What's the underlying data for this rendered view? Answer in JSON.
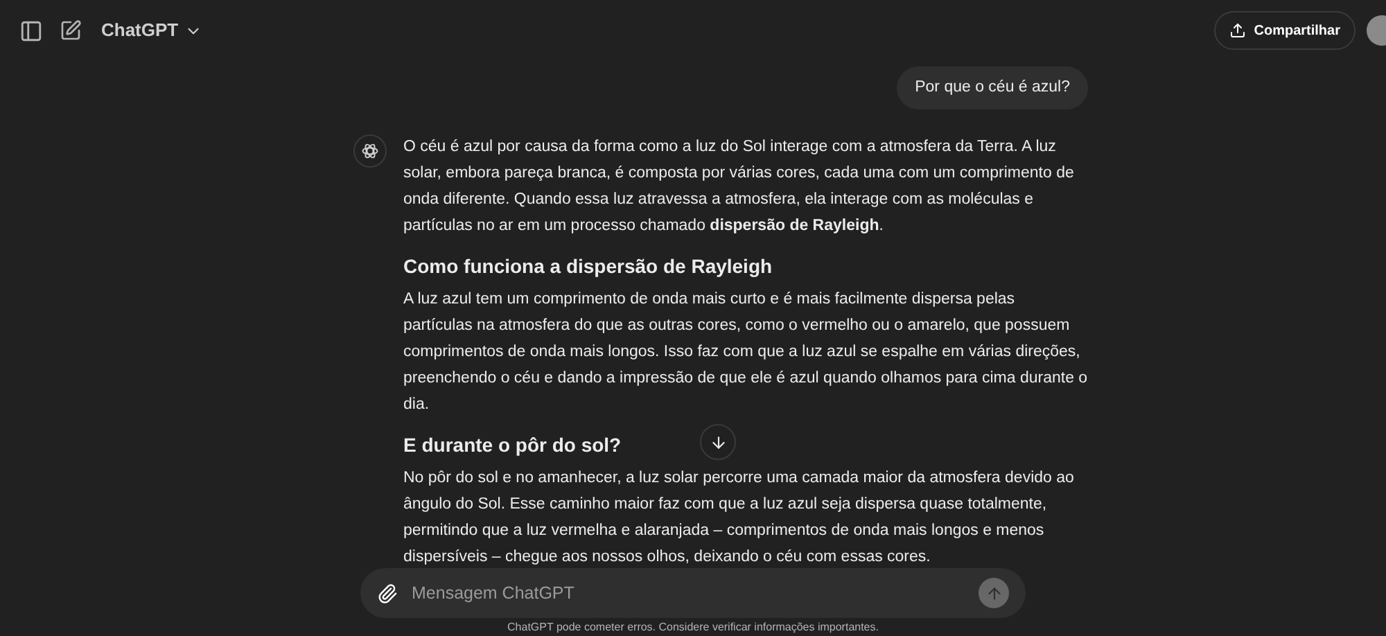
{
  "header": {
    "title": "ChatGPT",
    "share_button": "Compartilhar"
  },
  "user_message": "Por que o céu é azul?",
  "answer": [
    {
      "kind": "paragraph",
      "text": "O céu é azul por causa da forma como a luz do Sol interage com a atmosfera da Terra. A luz solar, embora pareça branca, é composta por várias cores, cada uma com um comprimento de onda diferente. Quando essa luz atravessa a atmosfera, ela interage com as moléculas e partículas no ar em um processo chamado **dispersão de Rayleigh**."
    },
    {
      "kind": "heading",
      "text": "Como funciona a dispersão de Rayleigh"
    },
    {
      "kind": "paragraph",
      "text": "A luz azul tem um comprimento de onda mais curto e é mais facilmente dispersa pelas partículas na atmosfera do que as outras cores, como o vermelho ou o amarelo, que possuem comprimentos de onda mais longos. Isso faz com que a luz azul se espalhe em várias direções, preenchendo o céu e dando a impressão de que ele é azul quando olhamos para cima durante o dia."
    },
    {
      "kind": "heading",
      "text": "E durante o pôr do sol?"
    },
    {
      "kind": "paragraph",
      "text": "No pôr do sol e no amanhecer, a luz solar percorre uma camada maior da atmosfera devido ao ângulo do Sol. Esse caminho maior faz com que a luz azul seja dispersa quase totalmente, permitindo que a luz vermelha e alaranjada – comprimentos de onda mais longos e menos dispersíveis – chegue aos nossos olhos, deixando o céu com essas cores."
    }
  ],
  "composer": {
    "placeholder": "Mensagem ChatGPT"
  },
  "footer": "ChatGPT pode cometer erros. Considere verificar informações importantes."
}
